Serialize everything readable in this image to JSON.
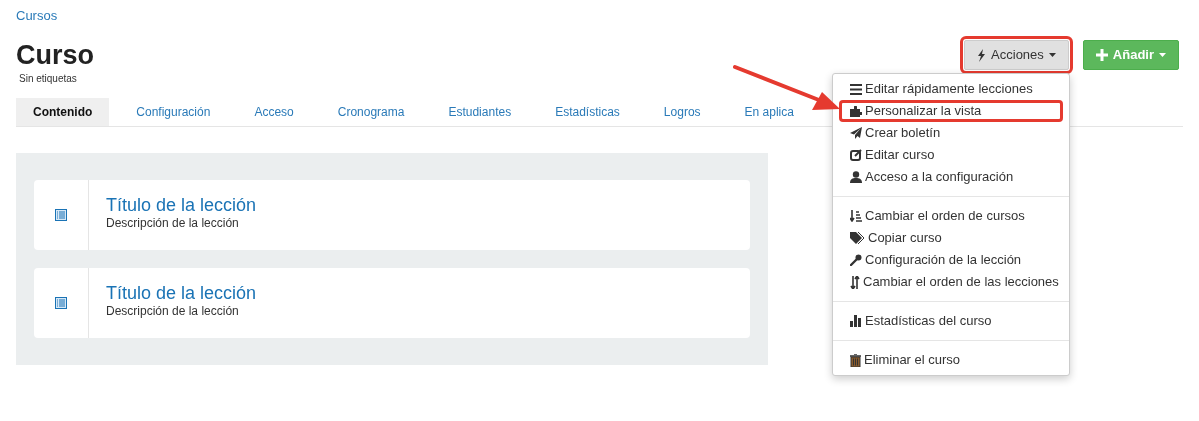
{
  "breadcrumb": "Cursos",
  "title": "Curso",
  "tags_note": "Sin etiquetas",
  "actions": [
    {
      "label": "Acciones",
      "kind": "actions",
      "highlighted": true
    },
    {
      "label": "Añadir",
      "kind": "add",
      "highlighted": false
    }
  ],
  "tabs": [
    {
      "label": "Contenido",
      "selected": true
    },
    {
      "label": "Configuración",
      "selected": false
    },
    {
      "label": "Acceso",
      "selected": false
    },
    {
      "label": "Cronograma",
      "selected": false
    },
    {
      "label": "Estudiantes",
      "selected": false
    },
    {
      "label": "Estadísticas",
      "selected": false
    },
    {
      "label": "Logros",
      "selected": false
    },
    {
      "label": "En aplica",
      "selected": false
    }
  ],
  "lessons": [
    {
      "title": "Título de la lección",
      "description": "Descripción de la lección"
    },
    {
      "title": "Título de la lección",
      "description": "Descripción de la lección"
    }
  ],
  "menu": {
    "groups": [
      [
        {
          "label": "Editar rápidamente lecciones",
          "highlighted": false
        },
        {
          "label": "Personalizar la vista",
          "highlighted": true
        },
        {
          "label": "Crear boletín",
          "highlighted": false
        },
        {
          "label": "Editar curso",
          "highlighted": false
        },
        {
          "label": "Acceso a la configuración",
          "highlighted": false
        }
      ],
      [
        {
          "label": "Cambiar el orden de cursos",
          "highlighted": false
        },
        {
          "label": "Copiar curso",
          "highlighted": false
        },
        {
          "label": "Configuración de la lección",
          "highlighted": false
        },
        {
          "label": "Cambiar el orden de las lecciones",
          "highlighted": false
        }
      ],
      [
        {
          "label": "Estadísticas del curso",
          "highlighted": false
        }
      ],
      [
        {
          "label": "Eliminar el curso",
          "highlighted": false
        }
      ]
    ]
  }
}
